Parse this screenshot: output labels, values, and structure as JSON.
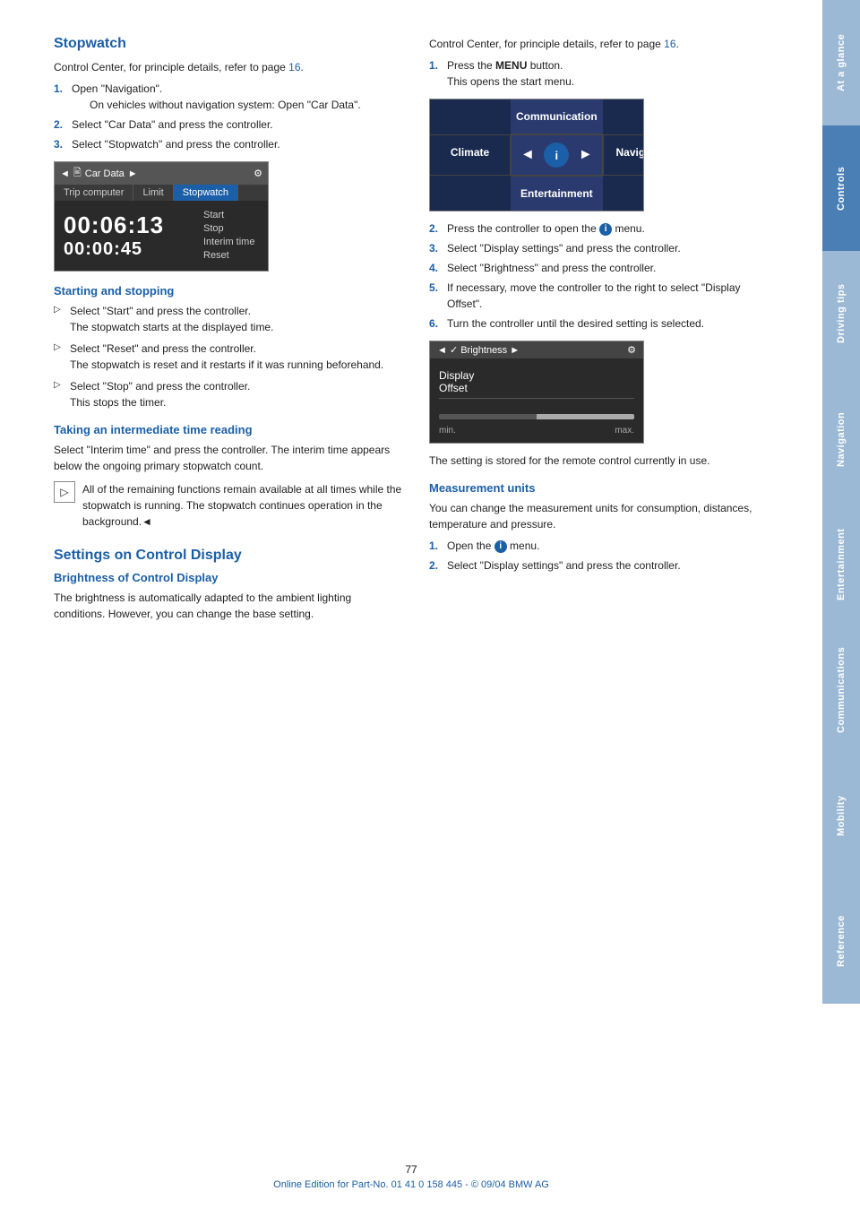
{
  "page": {
    "number": "77",
    "footer_text": "Online Edition for Part-No. 01 41 0 158 445 - © 09/04 BMW AG"
  },
  "sidebar": {
    "tabs": [
      {
        "id": "at-a-glance",
        "label": "At a glance",
        "active": false
      },
      {
        "id": "controls",
        "label": "Controls",
        "active": true
      },
      {
        "id": "driving-tips",
        "label": "Driving tips",
        "active": false
      },
      {
        "id": "navigation",
        "label": "Navigation",
        "active": false
      },
      {
        "id": "entertainment",
        "label": "Entertainment",
        "active": false
      },
      {
        "id": "communications",
        "label": "Communications",
        "active": false
      },
      {
        "id": "mobility",
        "label": "Mobility",
        "active": false
      },
      {
        "id": "reference",
        "label": "Reference",
        "active": false
      }
    ]
  },
  "stopwatch_section": {
    "title": "Stopwatch",
    "intro": "Control Center, for principle details, refer to page",
    "intro_page": "16",
    "intro_suffix": ".",
    "steps": [
      {
        "num": "1.",
        "main": "Open \"Navigation\".",
        "sub": "On vehicles without navigation system: Open \"Car Data\"."
      },
      {
        "num": "2.",
        "main": "Select \"Car Data\" and press the controller."
      },
      {
        "num": "3.",
        "main": "Select \"Stopwatch\" and press the controller."
      }
    ],
    "image": {
      "titlebar": "Car Data",
      "tabs": [
        "Trip computer",
        "Limit",
        "Stopwatch"
      ],
      "active_tab": "Stopwatch",
      "time1": "00:06:13",
      "time2": "00:00:45",
      "controls": [
        "Start",
        "Stop",
        "Interim time",
        "Reset"
      ]
    },
    "starting_stopping": {
      "title": "Starting and stopping",
      "bullets": [
        {
          "main": "Select \"Start\" and press the controller.",
          "sub": "The stopwatch starts at the displayed time."
        },
        {
          "main": "Select \"Reset\" and press the controller.",
          "sub": "The stopwatch is reset and it restarts if it was running beforehand."
        },
        {
          "main": "Select \"Stop\" and press the controller.",
          "sub": "This stops the timer."
        }
      ]
    },
    "interim_time": {
      "title": "Taking an intermediate time reading",
      "intro": "Select \"Interim time\" and press the controller. The interim time appears below the ongoing primary stopwatch count.",
      "note": "All of the remaining functions remain available at all times while the stopwatch is running. The stopwatch continues operation in the background.◄"
    }
  },
  "settings_section": {
    "title": "Settings on Control Display",
    "brightness": {
      "title": "Brightness of Control Display",
      "intro": "The brightness is automatically adapted to the ambient lighting conditions. However, you can change the base setting.",
      "steps_right": [
        {
          "num": "1.",
          "main": "Press the",
          "bold": "MENU",
          "suffix": " button.",
          "sub": "This opens the start menu."
        },
        {
          "num": "2.",
          "main": "Press the controller to open the",
          "icon": "i",
          "suffix": " menu."
        },
        {
          "num": "3.",
          "main": "Select \"Display settings\" and press the controller."
        },
        {
          "num": "4.",
          "main": "Select \"Brightness\" and press the controller."
        },
        {
          "num": "5.",
          "main": "If necessary, move the controller to the right to select \"Display Offset\"."
        },
        {
          "num": "6.",
          "main": "Turn the controller until the desired setting is selected."
        }
      ],
      "nav_image": {
        "top_center": "Communication",
        "left": "Climate",
        "center_icon": "i",
        "right": "Navigation",
        "bottom_center": "Entertainment"
      },
      "brightness_image": {
        "titlebar": "Brightness",
        "item": "Display\nOffset",
        "slider_min": "min.",
        "slider_max": "max."
      },
      "stored_text": "The setting is stored for the remote control currently in use."
    },
    "measurement_units": {
      "title": "Measurement units",
      "intro": "You can change the measurement units for consumption, distances, temperature and pressure.",
      "steps": [
        {
          "num": "1.",
          "main": "Open the",
          "icon": "i",
          "suffix": " menu."
        },
        {
          "num": "2.",
          "main": "Select \"Display settings\" and press the controller."
        }
      ]
    }
  }
}
